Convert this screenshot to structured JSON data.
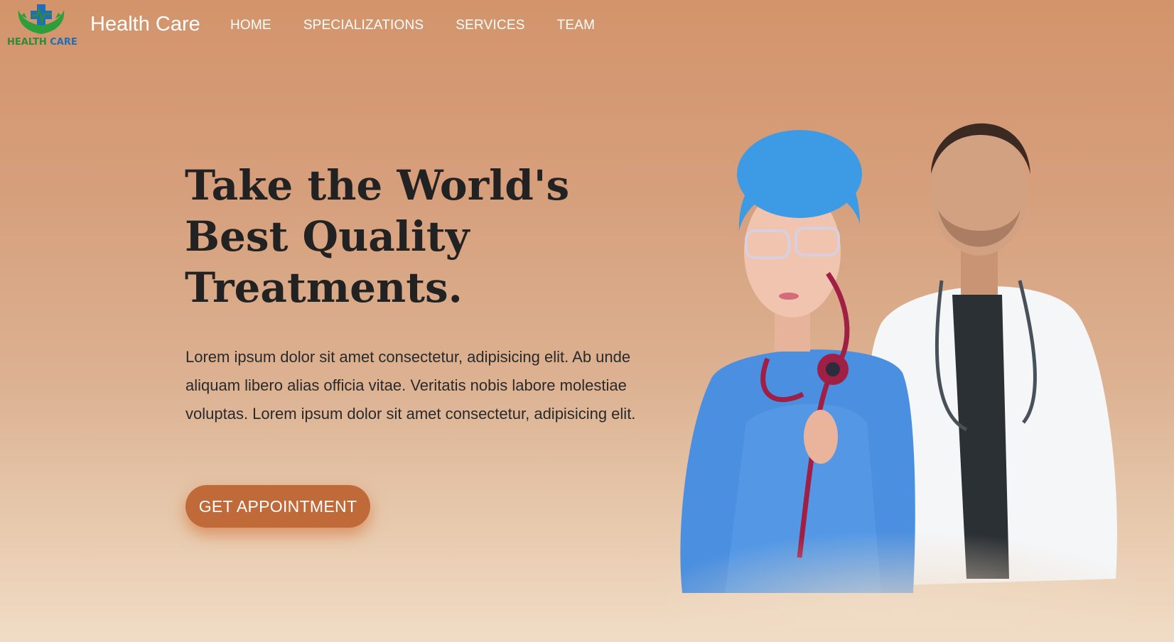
{
  "nav": {
    "logo_text_1": "HEALTH",
    "logo_text_2": "CARE",
    "brand": "Health Care",
    "links": [
      "HOME",
      "SPECIALIZATIONS",
      "SERVICES",
      "TEAM"
    ]
  },
  "hero": {
    "title_lines": [
      "Take the World's",
      "Best Quality",
      "Treatments."
    ],
    "paragraph": "Lorem ipsum dolor sit amet consectetur, adipisicing elit. Ab unde aliquam libero alias officia vitae. Veritatis nobis labore molestiae voluptas. Lorem ipsum dolor sit amet consectetur, adipisicing elit.",
    "cta_label": "GET APPOINTMENT"
  },
  "colors": {
    "accent": "#c06a3a",
    "logo_green": "#2e8b3a",
    "logo_blue": "#1f6fb8"
  },
  "icons": {
    "logo": "hands-cross-icon"
  }
}
